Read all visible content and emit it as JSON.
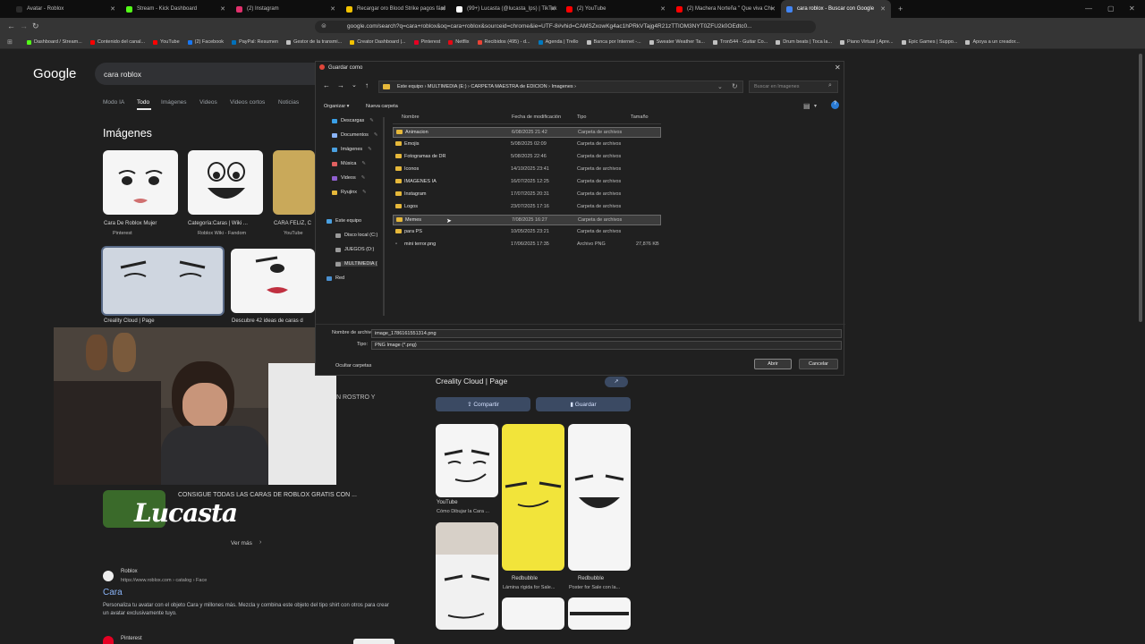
{
  "tabs": [
    {
      "label": "Avatar - Roblox",
      "color": "#2b2b2b"
    },
    {
      "label": "Stream - Kick Dashboard",
      "color": "#53fc18"
    },
    {
      "label": "(2) Instagram",
      "color": "#e1306c"
    },
    {
      "label": "Recargar oro Blood Strike pagos fácil",
      "color": "#f2c200"
    },
    {
      "label": "(99+) Lucasta (@lucasta_lps) | TikTok",
      "color": "#ffffff"
    },
    {
      "label": "(2) YouTube",
      "color": "#ff0000"
    },
    {
      "label": "(2) Machera Norteña \" Que viva Chi",
      "color": "#ff0000"
    },
    {
      "label": "cara roblox - Buscar con Google",
      "color": "#4285f4",
      "active": true
    }
  ],
  "omnibox": {
    "url": "google.com/search?q=cara+roblox&oq=cara+roblox&sourceid=chrome&ie=UTF-8#vhid=CAMSZxowKg4ac1hPRkVTajg4R21zTTlOM3NYT0ZFU2k0OEdtc0..."
  },
  "bookmarks": [
    {
      "label": "Dashboard / Stream...",
      "color": "#53fc18"
    },
    {
      "label": "Contenido del canal...",
      "color": "#ff0000"
    },
    {
      "label": "YouTube",
      "color": "#ff0000"
    },
    {
      "label": "(2) Facebook",
      "color": "#1877f2"
    },
    {
      "label": "PayPal: Resumen",
      "color": "#0070ba"
    },
    {
      "label": "Gestor de la transmi...",
      "color": "#c0c0c0"
    },
    {
      "label": "Creator Dashboard |...",
      "color": "#f2c200"
    },
    {
      "label": "Pinterest",
      "color": "#e60023"
    },
    {
      "label": "Netflix",
      "color": "#e50914"
    },
    {
      "label": "Recibidos (495) - d...",
      "color": "#ea4335"
    },
    {
      "label": "Agenda | Trello",
      "color": "#0079bf"
    },
    {
      "label": "Banca por Internet -...",
      "color": "#c0c0c0"
    },
    {
      "label": "Sweater Weather Ta...",
      "color": "#c0c0c0"
    },
    {
      "label": "Tron544 - Guitar Co...",
      "color": "#c0c0c0"
    },
    {
      "label": "Drum beats | Toca la...",
      "color": "#c0c0c0"
    },
    {
      "label": "Piano Virtual | Apre...",
      "color": "#c0c0c0"
    },
    {
      "label": "Epic Games | Suppo...",
      "color": "#c0c0c0"
    },
    {
      "label": "Apoya a un creador...",
      "color": "#c0c0c0"
    }
  ],
  "google": {
    "logo": "Google",
    "query": "cara roblox",
    "tabs": [
      "Modo IA",
      "Todo",
      "Imágenes",
      "Videos",
      "Videos cortos",
      "Noticias"
    ],
    "images_heading": "Imágenes",
    "results": [
      {
        "caption": "Cara De Roblox Mujer",
        "source": "Pinterest"
      },
      {
        "caption": "Categoría:Caras | Wiki ...",
        "source": "Roblox Wiki - Fandom"
      },
      {
        "caption": "CARA FELIZ, C",
        "source": "YouTube"
      },
      {
        "caption": "Creality Cloud | Page",
        "source": ""
      },
      {
        "caption": "Descubre 42 ideas de caras d",
        "source": ""
      }
    ],
    "side_text": "N ROSTRO Y",
    "video_title": "CONSIGUE TODAS LAS CARAS DE ROBLOX GRATIS CON ...",
    "ver_mas": "Ver más",
    "result_site": "Roblox",
    "result_url": "https://www.roblox.com › catalog › Face",
    "result_title": "Cara",
    "result_snippet": "Personaliza tu avatar con el objeto Cara y millones más. Mezcla y combina este objeto del tipo shirt con otros para crear un avatar exclusivamente tuyo.",
    "next_site": "Pinterest"
  },
  "preview": {
    "title": "Creality Cloud | Page",
    "share": "Compartir",
    "save": "Guardar",
    "items": [
      {
        "source": "YouTube",
        "caption": "Cómo Dibujar la Cara ..."
      },
      {
        "source": "Redbubble",
        "caption": "Lámina rígida for Sale..."
      },
      {
        "source": "Redbubble",
        "caption": "Poster for Sale con la..."
      }
    ]
  },
  "overlay_logo": "Lucasta",
  "dialog": {
    "title": "Guardar como",
    "breadcrumb": "Este equipo  ›  MULTIMEDIA (E:)  ›  CARPETA MAESTRA de EDICION  ›  Imagenes  ›",
    "search_placeholder": "Buscar en Imagenes",
    "organize": "Organizar ▾",
    "new_folder": "Nueva carpeta",
    "sidebar": [
      "Descargas",
      "Documentos",
      "Imágenes",
      "Música",
      "Videos",
      "Ryujinx",
      "Este equipo",
      "Disco local (C:)",
      "JUEGOS (D:)",
      "MULTIMEDIA (",
      "Red"
    ],
    "columns": {
      "name": "Nombre",
      "date": "Fecha de modificación",
      "type": "Tipo",
      "size": "Tamaño"
    },
    "files": [
      {
        "name": "Animacion",
        "date": "6/08/2025 21:42",
        "type": "Carpeta de archivos",
        "size": "",
        "folder": true,
        "selected": true
      },
      {
        "name": "Emojis",
        "date": "5/08/2025 02:09",
        "type": "Carpeta de archivos",
        "size": "",
        "folder": true
      },
      {
        "name": "Fotogramas de DR",
        "date": "5/08/2025 22:46",
        "type": "Carpeta de archivos",
        "size": "",
        "folder": true
      },
      {
        "name": "Iconos",
        "date": "14/10/2025 23:41",
        "type": "Carpeta de archivos",
        "size": "",
        "folder": true
      },
      {
        "name": "IMAGENES IA",
        "date": "16/07/2025 12:25",
        "type": "Carpeta de archivos",
        "size": "",
        "folder": true
      },
      {
        "name": "Instagram",
        "date": "17/07/2025 20:31",
        "type": "Carpeta de archivos",
        "size": "",
        "folder": true
      },
      {
        "name": "Logos",
        "date": "23/07/2025 17:16",
        "type": "Carpeta de archivos",
        "size": "",
        "folder": true
      },
      {
        "name": "Memes",
        "date": "7/08/2025 16:27",
        "type": "Carpeta de archivos",
        "size": "",
        "folder": true,
        "selected": true
      },
      {
        "name": "para PS",
        "date": "10/05/2025 23:21",
        "type": "Carpeta de archivos",
        "size": "",
        "folder": true
      },
      {
        "name": "mini terror.png",
        "date": "17/06/2025 17:35",
        "type": "Archivo PNG",
        "size": "27,876 KB",
        "folder": false
      }
    ],
    "filename_label": "Nombre de archivo:",
    "filename": "image_1786161551314.png",
    "type_label": "Tipo:",
    "filetype": "PNG Image (*.png)",
    "hide_folders": "Ocultar carpetas",
    "save_btn": "Abrir",
    "cancel_btn": "Cancelar"
  }
}
